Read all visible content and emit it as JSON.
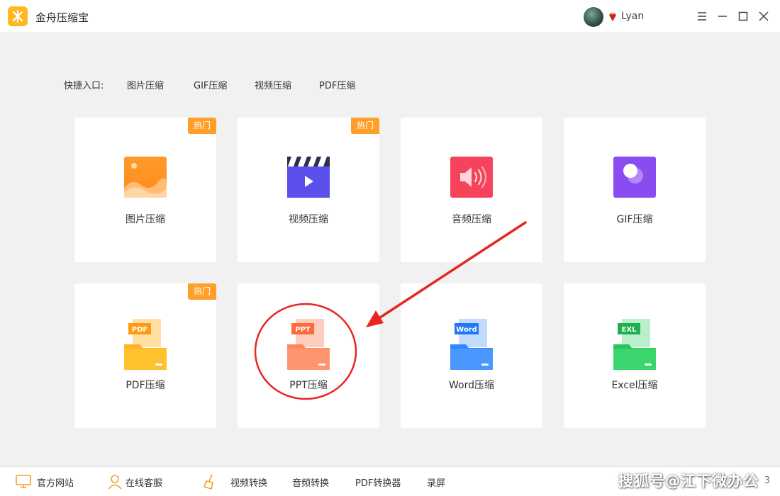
{
  "window": {
    "title": "金舟压缩宝",
    "user": "Lyan",
    "controls": [
      "menu-icon",
      "minimize-icon",
      "maximize-icon",
      "close-icon"
    ]
  },
  "quick_entry": {
    "label": "快捷入口:",
    "links": [
      "图片压缩",
      "GIF压缩",
      "视频压缩",
      "PDF压缩"
    ]
  },
  "cards": [
    {
      "label": "图片压缩",
      "badge": "热门",
      "icon": "image-icon"
    },
    {
      "label": "视频压缩",
      "badge": "热门",
      "icon": "video-icon"
    },
    {
      "label": "音频压缩",
      "icon": "audio-icon"
    },
    {
      "label": "GIF压缩",
      "icon": "gif-icon"
    },
    {
      "label": "PDF压缩",
      "badge": "热门",
      "icon": "pdf-folder-icon",
      "tag": "PDF"
    },
    {
      "label": "PPT压缩",
      "icon": "ppt-folder-icon",
      "tag": "PPT"
    },
    {
      "label": "Word压缩",
      "icon": "word-folder-icon",
      "tag": "Word"
    },
    {
      "label": "Excel压缩",
      "icon": "excel-folder-icon",
      "tag": "EXL"
    }
  ],
  "footer": {
    "items": [
      "官方网站",
      "在线客服",
      "视频转换",
      "音频转换",
      "PDF转换器",
      "录屏"
    ],
    "version": "3"
  },
  "watermark": "搜狐号@江下微办公",
  "colors": {
    "accent": "#ffb81f",
    "badge": "#ff9f2a",
    "annotation": "#e8261f"
  }
}
